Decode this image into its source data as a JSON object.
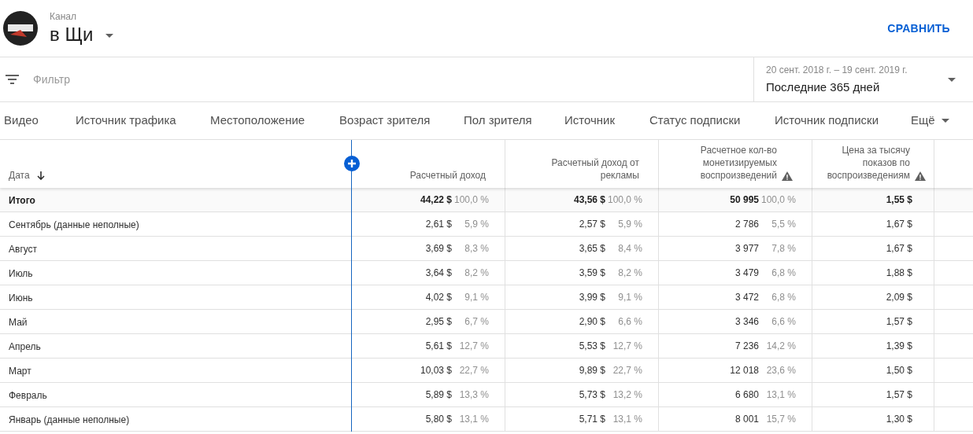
{
  "header": {
    "label": "Канал",
    "channel": "в Щи",
    "compare_button": "СРАВНИТЬ"
  },
  "filter": {
    "placeholder": "Фильтр"
  },
  "date_range": {
    "range": "20 сент. 2018 г. – 19 сент. 2019 г.",
    "value": "Последние 365 дней"
  },
  "tabs": [
    {
      "label": "Видео",
      "selected": false
    },
    {
      "label": "Источник трафика",
      "selected": false
    },
    {
      "label": "Местоположение",
      "selected": false
    },
    {
      "label": "Возраст зрителя",
      "selected": false
    },
    {
      "label": "Пол зрителя",
      "selected": false
    },
    {
      "label": "Источник",
      "selected": false
    },
    {
      "label": "Статус подписки",
      "selected": false
    },
    {
      "label": "Источник подписки",
      "selected": false
    }
  ],
  "more_tab": "Ещё",
  "table": {
    "columns": [
      {
        "label": "Дата",
        "sorted": true,
        "warning": false
      },
      {
        "label": "Расчетный доход",
        "sorted": false,
        "warning": false
      },
      {
        "label": "Расчетный доход от рекламы",
        "sorted": false,
        "warning": false
      },
      {
        "label": "Расчетное кол-во монетизируемых воспроизведений",
        "sorted": false,
        "warning": true
      },
      {
        "label": "Цена за тысячу показов по воспроизведениям",
        "sorted": false,
        "warning": true
      }
    ],
    "rows": [
      {
        "kind": "total",
        "cells": [
          {
            "value": "Итого"
          },
          {
            "value": "44,22 $",
            "share": "100,0 %"
          },
          {
            "value": "43,56 $",
            "share": "100,0 %"
          },
          {
            "value": "50 995",
            "share": "100,0 %"
          },
          {
            "value": "1,55 $"
          }
        ]
      },
      {
        "kind": "month",
        "cells": [
          {
            "value": "Сентябрь (данные неполные)"
          },
          {
            "value": "2,61 $",
            "share": "5,9 %"
          },
          {
            "value": "2,57 $",
            "share": "5,9 %"
          },
          {
            "value": "2 786",
            "share": "5,5 %"
          },
          {
            "value": "1,67 $"
          }
        ]
      },
      {
        "kind": "month",
        "cells": [
          {
            "value": "Август"
          },
          {
            "value": "3,69 $",
            "share": "8,3 %"
          },
          {
            "value": "3,65 $",
            "share": "8,4 %"
          },
          {
            "value": "3 977",
            "share": "7,8 %"
          },
          {
            "value": "1,67 $"
          }
        ]
      },
      {
        "kind": "month",
        "cells": [
          {
            "value": "Июль"
          },
          {
            "value": "3,64 $",
            "share": "8,2 %"
          },
          {
            "value": "3,59 $",
            "share": "8,2 %"
          },
          {
            "value": "3 479",
            "share": "6,8 %"
          },
          {
            "value": "1,88 $"
          }
        ]
      },
      {
        "kind": "month",
        "cells": [
          {
            "value": "Июнь"
          },
          {
            "value": "4,02 $",
            "share": "9,1 %"
          },
          {
            "value": "3,99 $",
            "share": "9,1 %"
          },
          {
            "value": "3 472",
            "share": "6,8 %"
          },
          {
            "value": "2,09 $"
          }
        ]
      },
      {
        "kind": "month",
        "cells": [
          {
            "value": "Май"
          },
          {
            "value": "2,95 $",
            "share": "6,7 %"
          },
          {
            "value": "2,90 $",
            "share": "6,6 %"
          },
          {
            "value": "3 346",
            "share": "6,6 %"
          },
          {
            "value": "1,57 $"
          }
        ]
      },
      {
        "kind": "month",
        "cells": [
          {
            "value": "Апрель"
          },
          {
            "value": "5,61 $",
            "share": "12,7 %"
          },
          {
            "value": "5,53 $",
            "share": "12,7 %"
          },
          {
            "value": "7 236",
            "share": "14,2 %"
          },
          {
            "value": "1,39 $"
          }
        ]
      },
      {
        "kind": "month",
        "cells": [
          {
            "value": "Март"
          },
          {
            "value": "10,03 $",
            "share": "22,7 %"
          },
          {
            "value": "9,89 $",
            "share": "22,7 %"
          },
          {
            "value": "12 018",
            "share": "23,6 %"
          },
          {
            "value": "1,50 $"
          }
        ]
      },
      {
        "kind": "month",
        "cells": [
          {
            "value": "Февраль"
          },
          {
            "value": "5,89 $",
            "share": "13,3 %"
          },
          {
            "value": "5,73 $",
            "share": "13,2 %"
          },
          {
            "value": "6 680",
            "share": "13,1 %"
          },
          {
            "value": "1,57 $"
          }
        ]
      },
      {
        "kind": "month",
        "cells": [
          {
            "value": "Январь (данные неполные)"
          },
          {
            "value": "5,80 $",
            "share": "13,1 %"
          },
          {
            "value": "5,71 $",
            "share": "13,1 %"
          },
          {
            "value": "8 001",
            "share": "15,7 %"
          },
          {
            "value": "1,30 $"
          }
        ]
      }
    ]
  }
}
